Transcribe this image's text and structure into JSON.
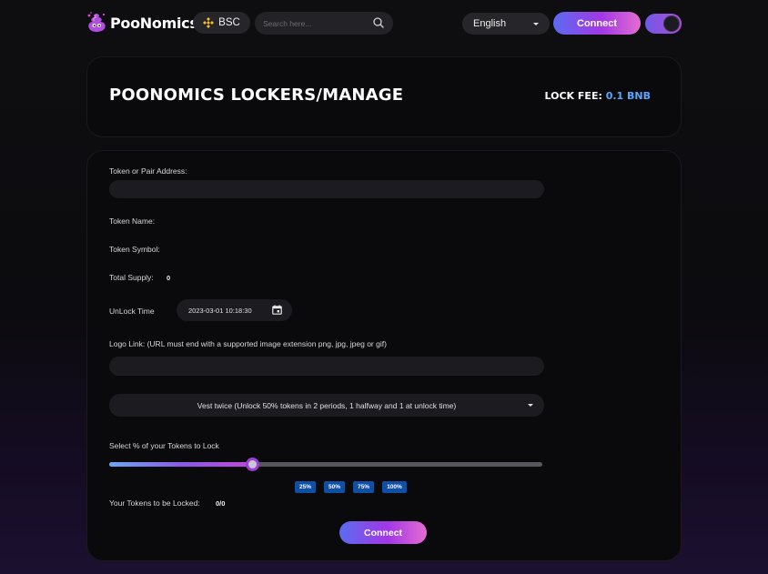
{
  "header": {
    "brand": "PooNomics",
    "chain_label": "BSC",
    "search_placeholder": "Search here...",
    "language": "English",
    "connect_label": "Connect"
  },
  "title_card": {
    "title": "POONOMICS LOCKERS/MANAGE",
    "lock_fee_label": "LOCK FEE:",
    "lock_fee_value": "0.1 BNB"
  },
  "form": {
    "token_address_label": "Token or Pair Address:",
    "token_address_value": "",
    "token_name_label": "Token Name:",
    "token_name_value": "",
    "token_symbol_label": "Token Symbol:",
    "token_symbol_value": "",
    "total_supply_label": "Total Supply:",
    "total_supply_value": "0",
    "unlock_time_label": "UnLock Time",
    "unlock_time_value": "2023-03-01 10:18:30",
    "logo_link_label": "Logo Link: (URL must end with a supported image extension png, jpg, jpeg or gif)",
    "logo_link_value": "",
    "vesting_selected": "Vest twice (Unlock 50% tokens in 2 periods, 1 halfway and 1 at unlock time)",
    "percent_label": "Select % of your Tokens to Lock",
    "percent_value": 33,
    "percent_buttons": [
      "25%",
      "50%",
      "75%",
      "100%"
    ],
    "tokens_locked_label": "Your Tokens to be Locked:",
    "tokens_locked_value": "0/0",
    "connect_label": "Connect"
  },
  "colors": {
    "accent_blue": "#5aa6ff",
    "button_gradient_start": "#5a6cf0",
    "button_gradient_end": "#e46cd0",
    "percent_button_bg": "#0f4fa8"
  }
}
